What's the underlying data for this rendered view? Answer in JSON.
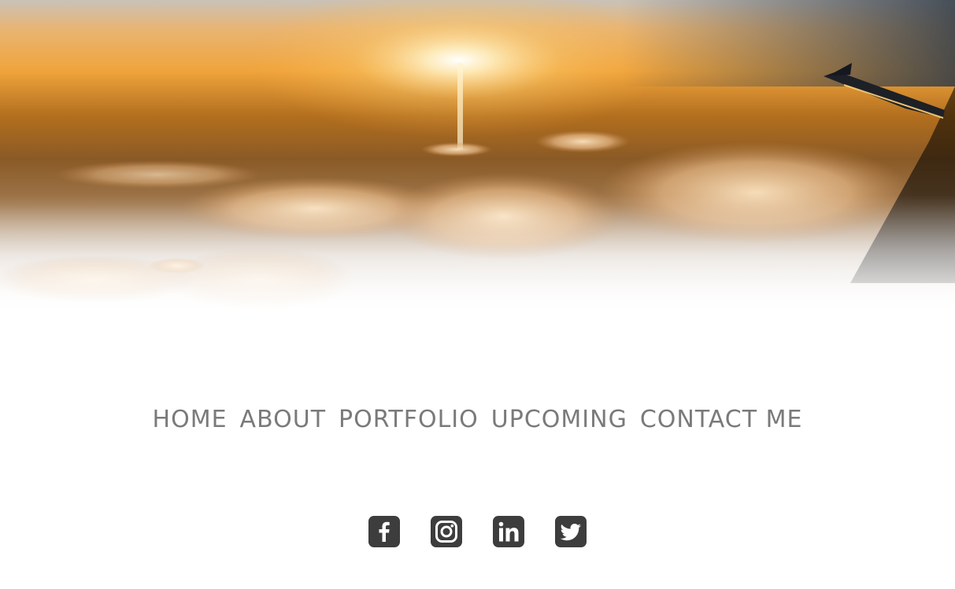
{
  "hero": {
    "image_icon": "sunset-above-clouds-airplane-wing-image"
  },
  "nav": {
    "items": [
      {
        "label": "HOME"
      },
      {
        "label": "ABOUT"
      },
      {
        "label": "PORTFOLIO"
      },
      {
        "label": "UPCOMING"
      },
      {
        "label": "CONTACT ME"
      }
    ],
    "text_color": "#7a7a7a"
  },
  "social": {
    "icons": [
      "facebook-icon",
      "instagram-icon",
      "linkedin-icon",
      "twitter-icon"
    ],
    "button_color": "#3d3d3d"
  }
}
